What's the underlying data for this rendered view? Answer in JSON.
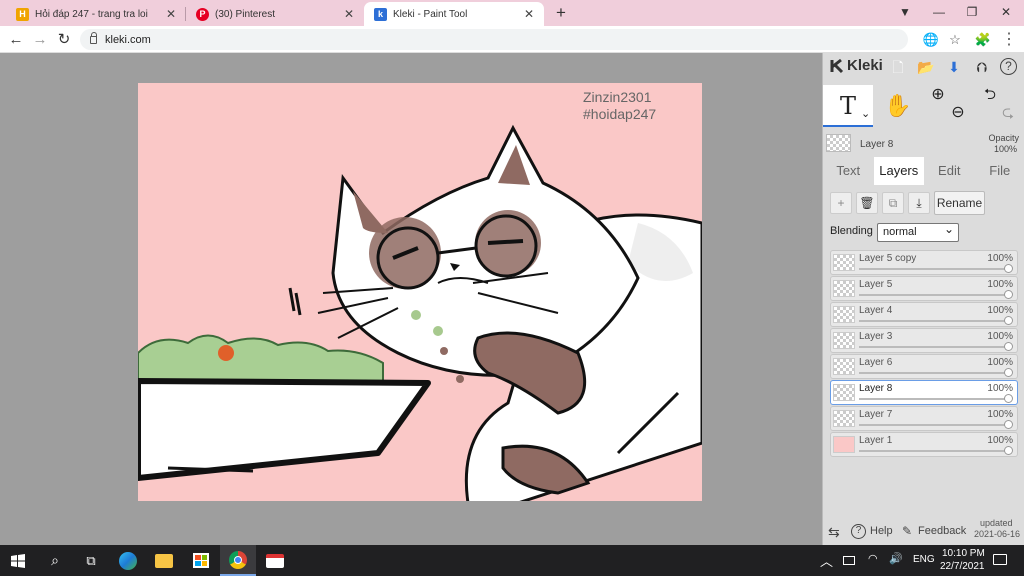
{
  "browser": {
    "tabs": [
      {
        "title": "Hỏi đáp 247 - trang tra loi",
        "favicon": "hoidap-icon",
        "close": "✕"
      },
      {
        "title": "(30) Pinterest",
        "favicon": "pinterest-icon",
        "close": "✕"
      },
      {
        "title": "Kleki - Paint Tool",
        "favicon": "kleki-icon",
        "close": "✕"
      }
    ],
    "new_tab": "+",
    "window_buttons": {
      "profile": "▼",
      "minimize": "—",
      "restore": "❐",
      "close": "✕"
    },
    "nav": {
      "back": "←",
      "forward": "→",
      "reload": "↻"
    },
    "url": "kleki.com",
    "toolbar_icons": {
      "translate": "🌐",
      "star": "☆",
      "extension": "🧩",
      "menu": "⋮"
    }
  },
  "canvas": {
    "watermark_line1": "Zinzin2301",
    "watermark_line2": "#hoidap247",
    "background": "#fac8c7"
  },
  "panel": {
    "logo_text": "Kleki",
    "header_icons": {
      "new": "🗋",
      "open": "📂",
      "save": "⬇",
      "share": "⮉",
      "help": "?"
    },
    "tools": {
      "text_tool": "T",
      "chevron": "⌄",
      "hand_tool": "✋",
      "zoom_in": "⊕",
      "zoom_out": "⊖",
      "undo": "⮌",
      "redo": "⮎"
    },
    "current_layer": {
      "name": "Layer 8",
      "opacity_label": "Opacity",
      "opacity_value": "100%"
    },
    "main_tabs": [
      "Text",
      "Layers",
      "Edit",
      "File"
    ],
    "active_tab": "Layers",
    "layer_buttons": {
      "add": "+",
      "delete": "🗑",
      "duplicate": "⧉",
      "merge": "⤓",
      "rename": "Rename"
    },
    "blending_label": "Blending",
    "blending_value": "normal",
    "layers": [
      {
        "name": "Layer 5 copy",
        "opacity": "100%",
        "selected": false
      },
      {
        "name": "Layer 5",
        "opacity": "100%",
        "selected": false
      },
      {
        "name": "Layer 4",
        "opacity": "100%",
        "selected": false
      },
      {
        "name": "Layer 3",
        "opacity": "100%",
        "selected": false
      },
      {
        "name": "Layer 6",
        "opacity": "100%",
        "selected": false
      },
      {
        "name": "Layer 8",
        "opacity": "100%",
        "selected": true
      },
      {
        "name": "Layer 7",
        "opacity": "100%",
        "selected": false
      },
      {
        "name": "Layer 1",
        "opacity": "100%",
        "selected": false
      }
    ],
    "footer": {
      "swap": "⇆",
      "help": "Help",
      "feedback": "Feedback",
      "updated_label": "updated",
      "updated_date": "2021-06-16"
    }
  },
  "taskbar": {
    "apps": [
      "windows-start",
      "search",
      "task-view",
      "edge",
      "file-explorer",
      "store",
      "chrome",
      "kleki-app"
    ],
    "tray": {
      "chevron": "︿",
      "lang": "ENG",
      "time": "10:10 PM",
      "date": "22/7/2021"
    }
  },
  "colors": {
    "accent": "#2c6fd6",
    "tabbar": "#f0cedb",
    "workspace": "#9e9e9e",
    "panel": "#dcdcdc"
  }
}
